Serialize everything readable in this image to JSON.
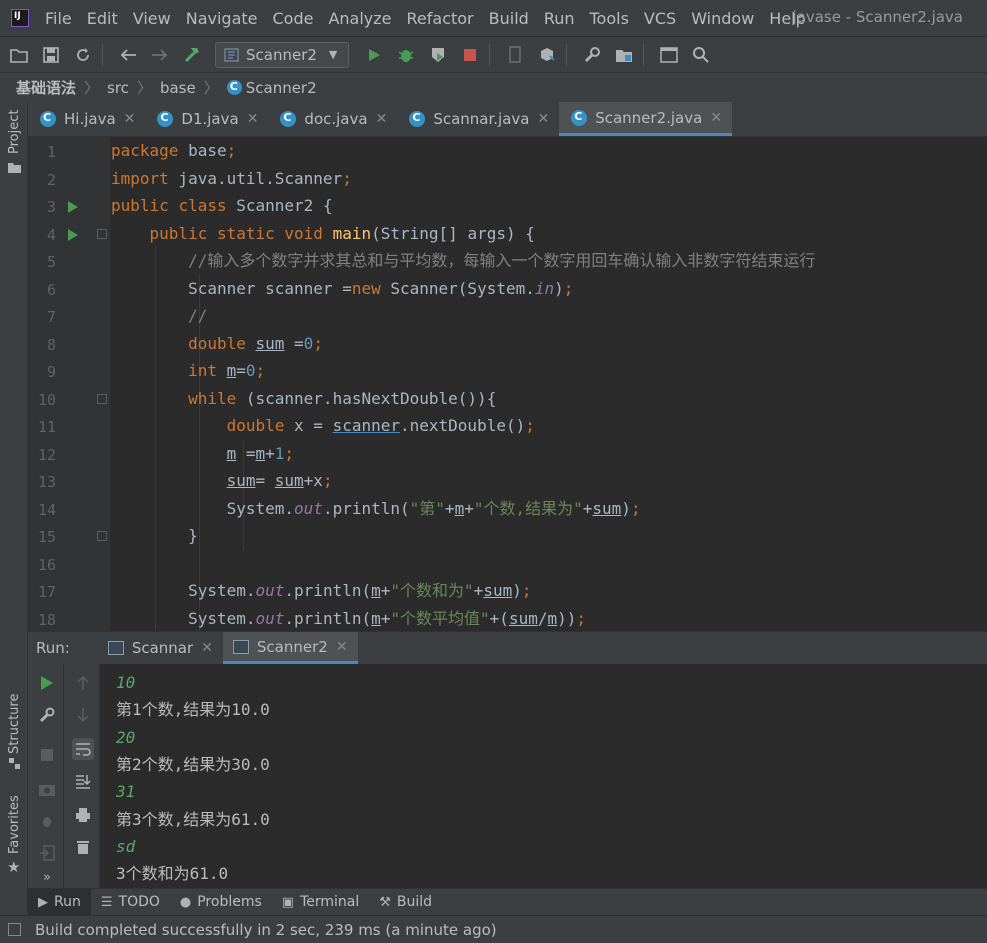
{
  "window_title": "javase - Scanner2.java",
  "menu": [
    "File",
    "Edit",
    "View",
    "Navigate",
    "Code",
    "Analyze",
    "Refactor",
    "Build",
    "Run",
    "Tools",
    "VCS",
    "Window",
    "Help"
  ],
  "toolbar": {
    "run_config": "Scanner2"
  },
  "breadcrumb": [
    "基础语法",
    "src",
    "base",
    "Scanner2"
  ],
  "left_strip": {
    "project": "Project",
    "structure": "Structure",
    "favorites": "Favorites"
  },
  "tabs": [
    {
      "label": "Hi.java",
      "active": false
    },
    {
      "label": "D1.java",
      "active": false
    },
    {
      "label": "doc.java",
      "active": false
    },
    {
      "label": "Scannar.java",
      "active": false
    },
    {
      "label": "Scanner2.java",
      "active": true
    }
  ],
  "editor": {
    "line_numbers": [
      "1",
      "2",
      "3",
      "4",
      "5",
      "6",
      "7",
      "8",
      "9",
      "10",
      "11",
      "12",
      "13",
      "14",
      "15",
      "16",
      "17",
      "18"
    ],
    "lines": [
      "package base;",
      "import java.util.Scanner;",
      "public class Scanner2 {",
      "    public static void main(String[] args) {",
      "        //输入多个数字并求其总和与平均数，每输入一个数字用回车确认输入非数字符结束运行",
      "        Scanner scanner =new Scanner(System.in);",
      "        //",
      "        double sum =0;",
      "        int m=0;",
      "        while (scanner.hasNextDouble()){",
      "            double x = scanner.nextDouble();",
      "            m =m+1;",
      "            sum= sum+x;",
      "            System.out.println(\"第\"+m+\"个数,结果为\"+sum);",
      "        }",
      "",
      "        System.out.println(m+\"个数和为\"+sum);",
      "        System.out.println(m+\"个数平均值\"+(sum/m));"
    ]
  },
  "run_panel": {
    "title": "Run:",
    "tabs": [
      {
        "label": "Scannar",
        "active": false
      },
      {
        "label": "Scanner2",
        "active": true
      }
    ],
    "console": [
      {
        "text": "10",
        "type": "input"
      },
      {
        "text": "第1个数,结果为10.0",
        "type": "output"
      },
      {
        "text": "20",
        "type": "input"
      },
      {
        "text": "第2个数,结果为30.0",
        "type": "output"
      },
      {
        "text": "31",
        "type": "input"
      },
      {
        "text": "第3个数,结果为61.0",
        "type": "output"
      },
      {
        "text": "sd",
        "type": "input"
      },
      {
        "text": "3个数和为61.0",
        "type": "output"
      }
    ]
  },
  "bottom_tabs": [
    "Run",
    "TODO",
    "Problems",
    "Terminal",
    "Build"
  ],
  "status": "Build completed successfully in 2 sec, 239 ms (a minute ago)",
  "colors": {
    "keyword": "#cc7832",
    "method": "#ffc66d",
    "number": "#6897bb",
    "comment": "#808080",
    "string": "#6a8759",
    "static_field": "#9876aa",
    "console_input": "#59a869",
    "accent": "#4a88c7"
  }
}
